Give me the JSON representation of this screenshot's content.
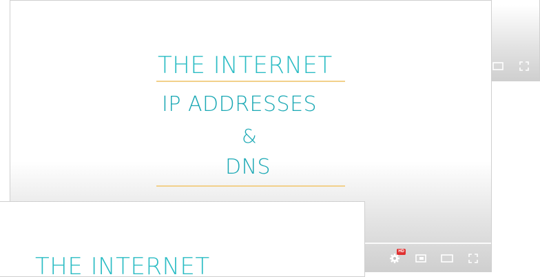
{
  "slide": {
    "title": "THE INTERNET",
    "subtitle_line1": "IP ADDRESSES",
    "subtitle_line2": "&",
    "subtitle_line3": "DNS"
  },
  "player": {
    "hd_badge": "HD",
    "controls": [
      "settings-icon",
      "miniplayer-icon",
      "theater-mode-icon",
      "fullscreen-icon"
    ]
  },
  "colors": {
    "title_teal": "#2bbcc4",
    "subtitle_teal": "#1aa8b4",
    "rule_gold": "#f2d08a",
    "hd_red": "#e03131"
  }
}
